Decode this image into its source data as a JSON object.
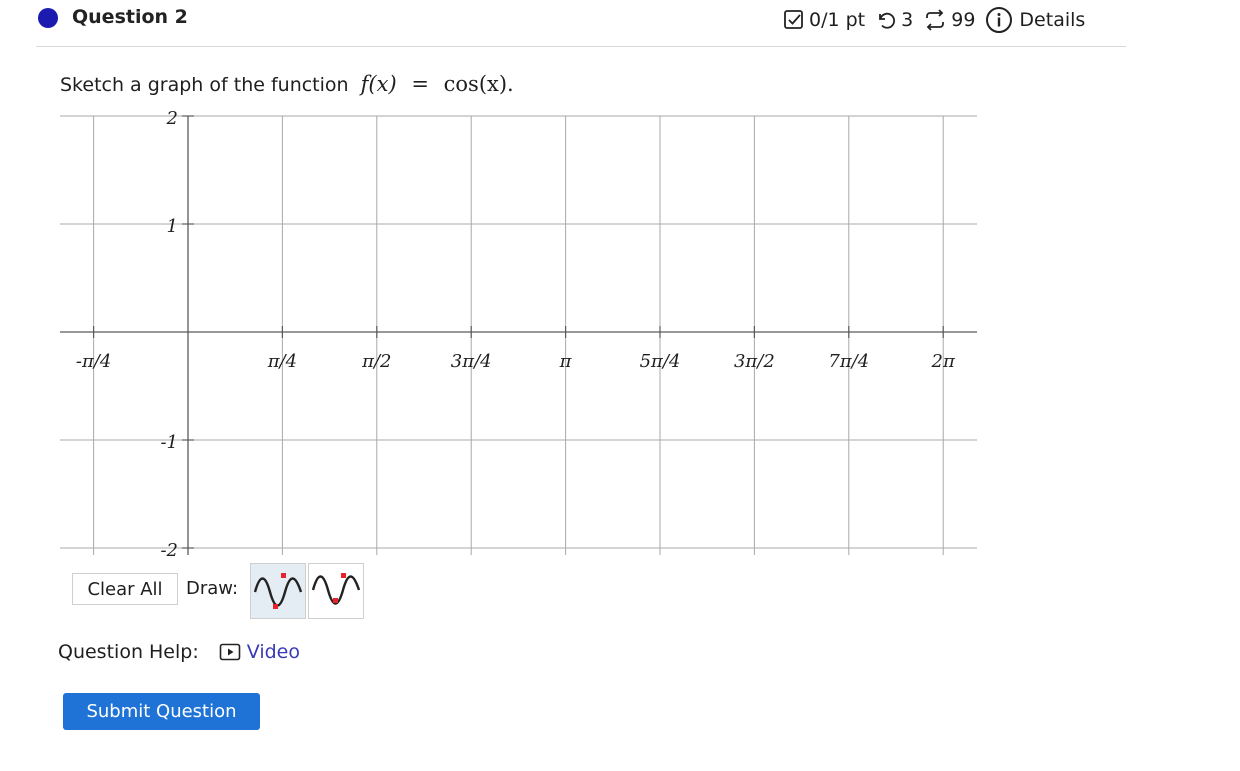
{
  "question": {
    "title": "Question 2",
    "score": "0/1 pt",
    "attempts": "3",
    "tries": "99",
    "details_label": "Details"
  },
  "prompt": {
    "text": "Sketch a graph of the function",
    "math_lhs": "f(x)",
    "math_eq": "=",
    "math_rhs": "cos(x)."
  },
  "graph": {
    "type": "scatter",
    "x_ticks": [
      "-π/4",
      "π/4",
      "π/2",
      "3π/4",
      "π",
      "5π/4",
      "3π/2",
      "7π/4",
      "2π"
    ],
    "y_ticks": [
      "2",
      "1",
      "-1",
      "-2"
    ],
    "xlim": [
      "-π/4",
      "2π"
    ],
    "ylim": [
      -2,
      2
    ],
    "grid": true,
    "points": []
  },
  "toolbar": {
    "clear_label": "Clear All",
    "draw_label": "Draw:"
  },
  "help": {
    "label": "Question Help:",
    "video_label": "Video"
  },
  "submit_label": "Submit Question",
  "colors": {
    "accent": "#1f73d6",
    "link": "#3a3ab8",
    "status_dot": "#1b1bb0",
    "handle": "#e8222a"
  }
}
